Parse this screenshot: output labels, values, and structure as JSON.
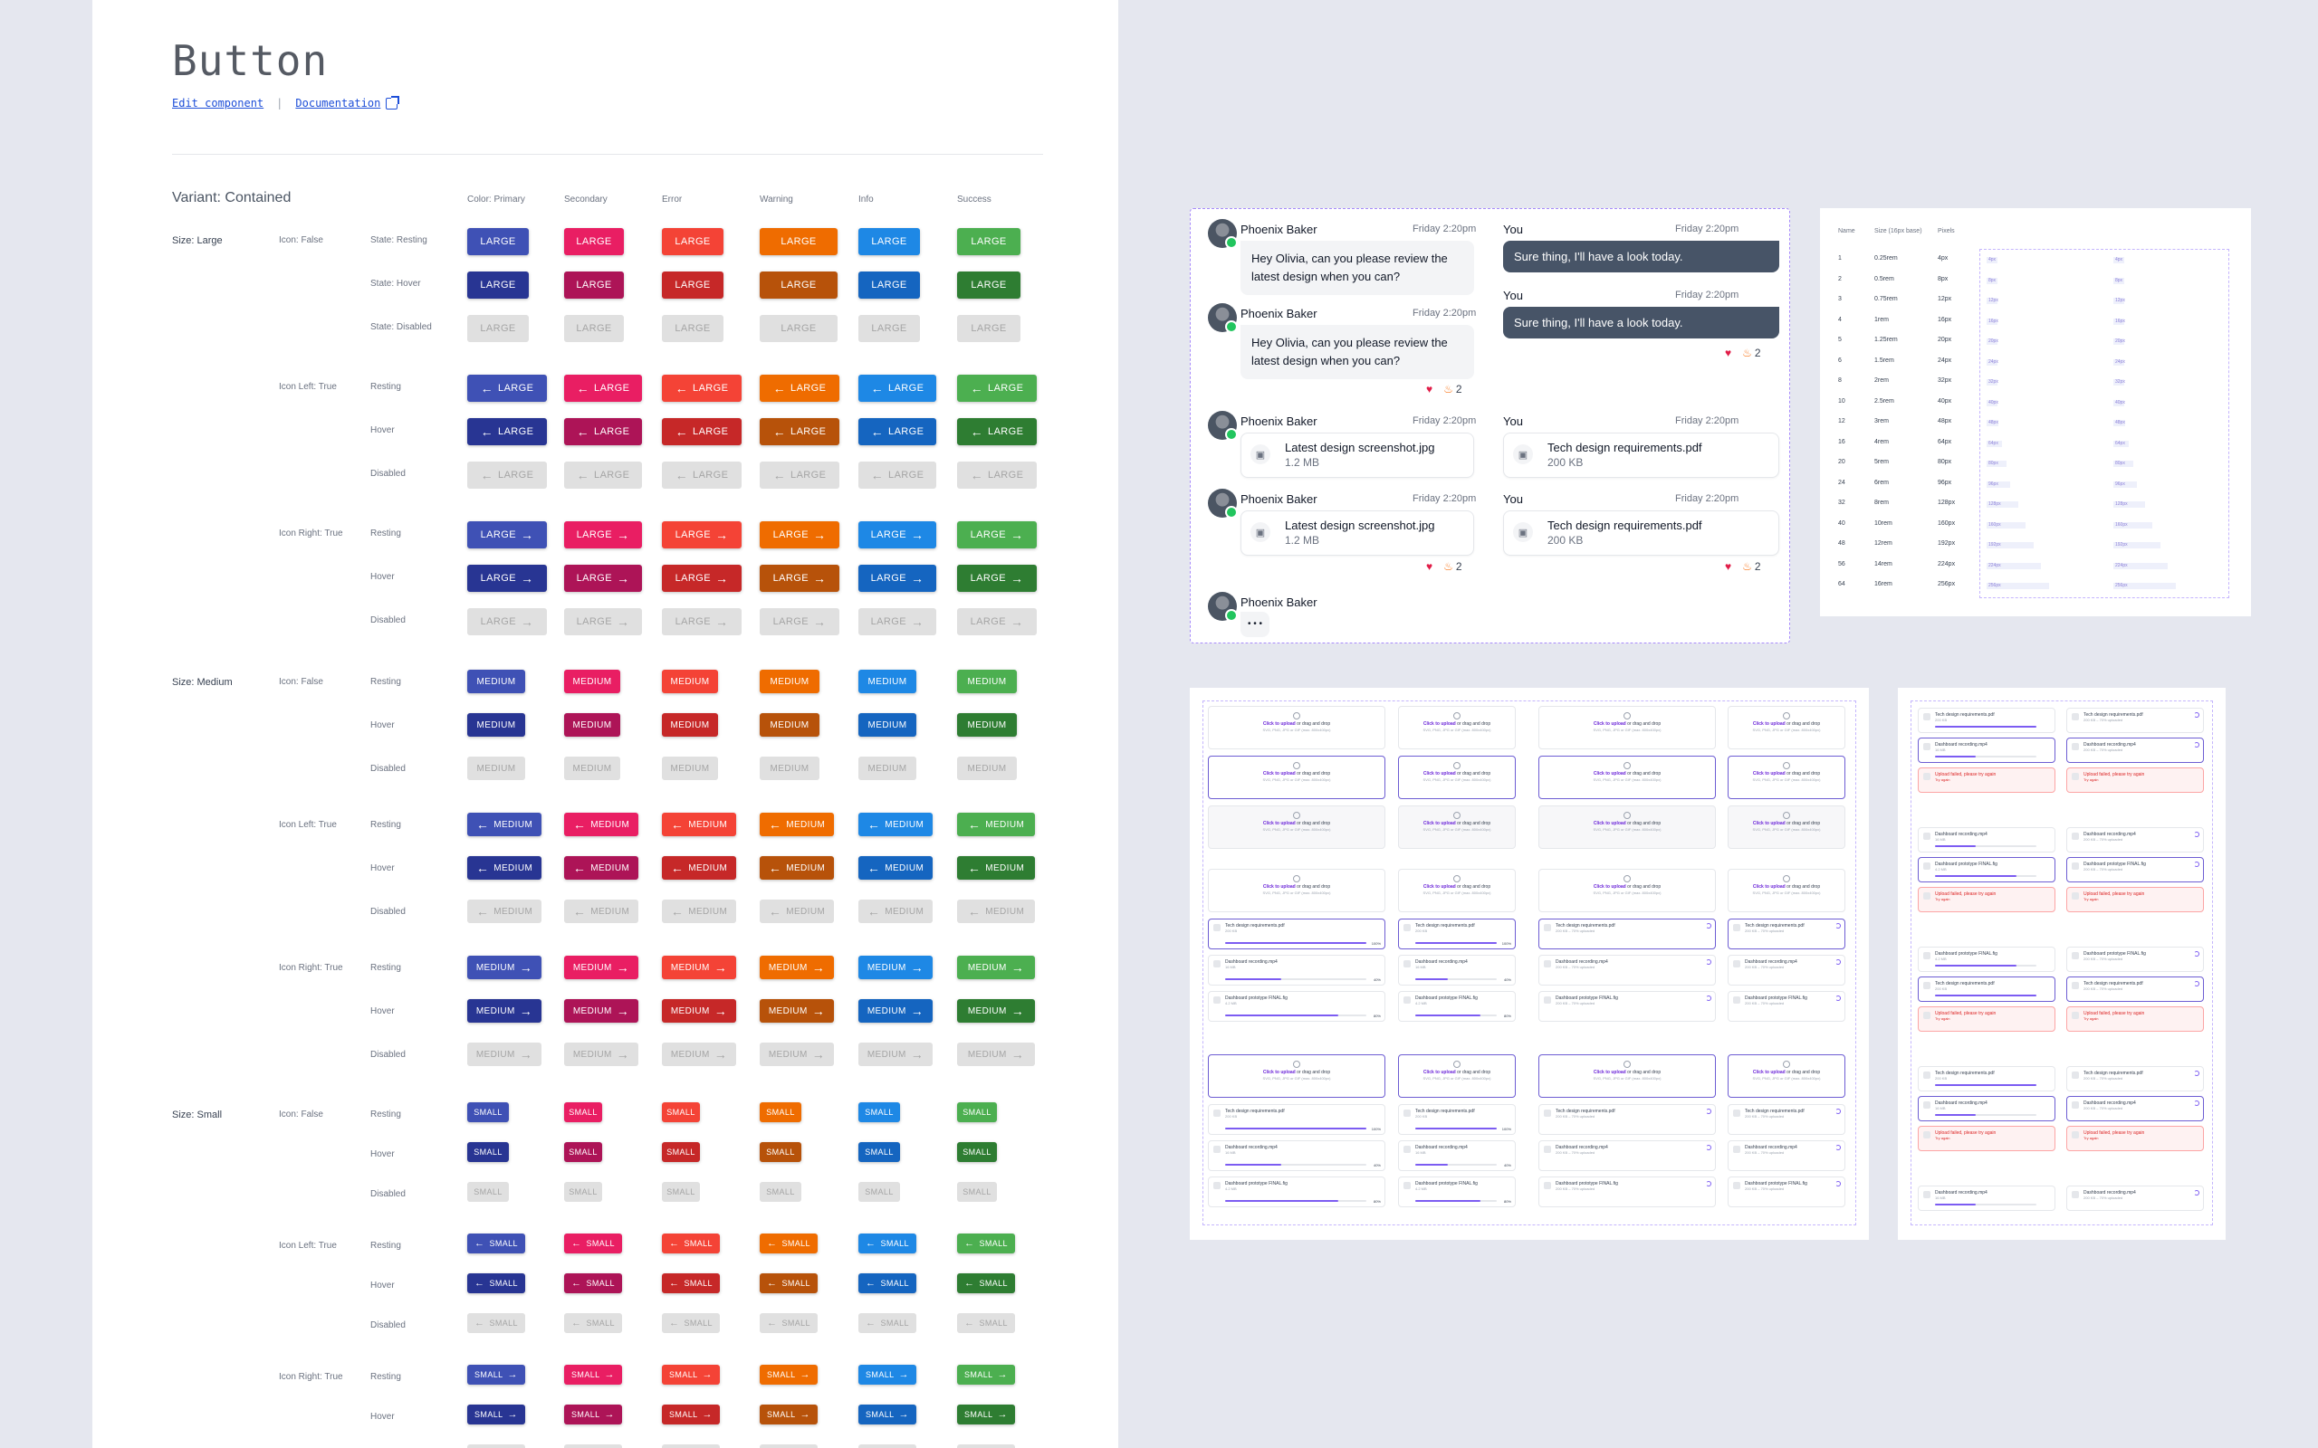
{
  "page": {
    "title": "Button",
    "edit_link": "Edit component",
    "separator": "|",
    "doc_link": "Documentation",
    "variant_heading": "Variant: Contained"
  },
  "columns": [
    "Color: Primary",
    "Secondary",
    "Error",
    "Warning",
    "Info",
    "Success"
  ],
  "colors": {
    "resting": [
      "#3f51b5",
      "#e91e63",
      "#f44336",
      "#ef6c00",
      "#1e88e5",
      "#4caf50"
    ],
    "hover": [
      "#283593",
      "#ad1457",
      "#c62828",
      "#b7520a",
      "#1565c0",
      "#2e7d32"
    ],
    "disabled_bg": "#e0e0e0",
    "disabled_text": "#a5a5a5"
  },
  "sizes": [
    {
      "label": "Size: Large",
      "text": "LARGE"
    },
    {
      "label": "Size: Medium",
      "text": "MEDIUM"
    },
    {
      "label": "Size: Small",
      "text": "SMALL"
    }
  ],
  "groups": [
    {
      "label": "Icon: False",
      "states": [
        "State: Resting",
        "State: Hover",
        "State: Disabled"
      ]
    },
    {
      "label": "Icon Left: True",
      "states": [
        "Resting",
        "Hover",
        "Disabled"
      ]
    },
    {
      "label": "Icon Right: True",
      "states": [
        "Resting",
        "Hover",
        "Disabled"
      ]
    }
  ],
  "groups_after_large": [
    {
      "label": "Icon: False",
      "states": [
        "Resting",
        "Hover",
        "Disabled"
      ]
    },
    {
      "label": "Icon Left: True",
      "states": [
        "Resting",
        "Hover",
        "Disabled"
      ]
    },
    {
      "label": "Icon Right: True",
      "states": [
        "Resting",
        "Hover",
        "Disabled"
      ]
    }
  ],
  "icons": {
    "left": "arrow-left-icon",
    "right": "arrow-right-icon"
  },
  "chat": {
    "messages": [
      {
        "name": "Phoenix Baker",
        "time": "Friday 2:20pm",
        "text": "Hey Olivia, can you please review the latest design when you can?"
      },
      {
        "name": "You",
        "time": "Friday 2:20pm",
        "text": "Sure thing, I'll have a look today."
      },
      {
        "name": "Phoenix Baker",
        "time": "Friday 2:20pm",
        "text": "Hey Olivia, can you please review the latest design when you can?"
      },
      {
        "name": "You",
        "time": "Friday 2:20pm",
        "text": "Sure thing, I'll have a look today."
      },
      {
        "name": "Phoenix Baker",
        "time": "Friday 2:20pm",
        "file": "Latest design screenshot.jpg",
        "size": "1.2 MB"
      },
      {
        "name": "You",
        "time": "Friday 2:20pm",
        "file": "Tech design requirements.pdf",
        "size": "200 KB"
      },
      {
        "name": "Phoenix Baker",
        "time": "Friday 2:20pm",
        "file": "Latest design screenshot.jpg",
        "size": "1.2 MB"
      },
      {
        "name": "You",
        "time": "Friday 2:20pm",
        "file": "Tech design requirements.pdf",
        "size": "200 KB"
      },
      {
        "name": "Phoenix Baker",
        "typing": "• • •"
      }
    ],
    "reaction_count": "2"
  },
  "spacing": {
    "headers": [
      "Name",
      "Size (16px base)",
      "Pixels"
    ],
    "rows": [
      [
        "1",
        "0.25rem",
        "4px"
      ],
      [
        "2",
        "0.5rem",
        "8px"
      ],
      [
        "3",
        "0.75rem",
        "12px"
      ],
      [
        "4",
        "1rem",
        "16px"
      ],
      [
        "5",
        "1.25rem",
        "20px"
      ],
      [
        "6",
        "1.5rem",
        "24px"
      ],
      [
        "8",
        "2rem",
        "32px"
      ],
      [
        "10",
        "2.5rem",
        "40px"
      ],
      [
        "12",
        "3rem",
        "48px"
      ],
      [
        "16",
        "4rem",
        "64px"
      ],
      [
        "20",
        "5rem",
        "80px"
      ],
      [
        "24",
        "6rem",
        "96px"
      ],
      [
        "32",
        "8rem",
        "128px"
      ],
      [
        "40",
        "10rem",
        "160px"
      ],
      [
        "48",
        "12rem",
        "192px"
      ],
      [
        "56",
        "14rem",
        "224px"
      ],
      [
        "64",
        "16rem",
        "256px"
      ]
    ]
  },
  "upload": {
    "cta": "Click to upload",
    "cta_rest": " or drag and drop",
    "hint": "SVG, PNG, JPG or GIF (max. 800x400px)",
    "files": [
      {
        "name": "Tech design requirements.pdf",
        "size": "200 KB",
        "pct": "100%"
      },
      {
        "name": "Dashboard recording.mp4",
        "size": "16 MB",
        "pct": "40%"
      },
      {
        "name": "Dashboard prototype FINAL.fig",
        "size": "4.2 MB",
        "pct": "80%"
      }
    ],
    "uploading": "200 KB – 70% uploaded",
    "error_title": "Upload failed, please try again",
    "try_again": "Try again"
  }
}
